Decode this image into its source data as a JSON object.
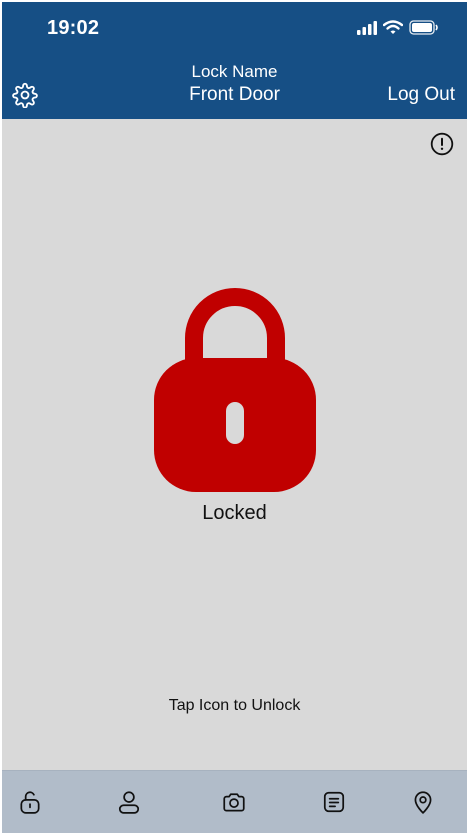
{
  "status_bar": {
    "time": "19:02",
    "icons": [
      "cellular-signal-icon",
      "wifi-icon",
      "battery-icon"
    ]
  },
  "header": {
    "caption": "Lock Name",
    "lock_name": "Front Door",
    "logout_label": "Log Out",
    "settings_icon": "gear-icon"
  },
  "main": {
    "info_icon": "info-icon",
    "lock_icon": "padlock-locked-icon",
    "status": "Locked",
    "hint": "Tap Icon to Unlock"
  },
  "bottom_nav": {
    "items": [
      "unlock-icon",
      "user-icon",
      "camera-icon",
      "log-icon",
      "location-icon"
    ]
  },
  "colors": {
    "header_bg": "#164f85",
    "page_bg": "#d9d9d9",
    "nav_bg": "#b1bcc9",
    "lock_red": "#c00000"
  }
}
